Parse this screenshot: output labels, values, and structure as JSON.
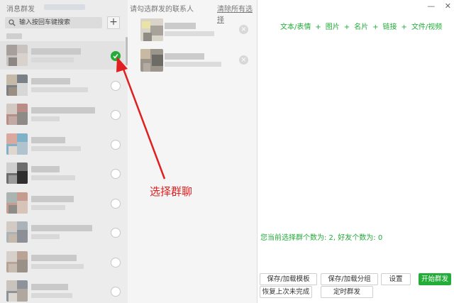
{
  "left": {
    "title": "消息群发",
    "search_placeholder": "输入按回车键搜索",
    "add_label": "+",
    "contacts": [
      {
        "checked": true
      },
      {
        "checked": false
      },
      {
        "checked": false
      },
      {
        "checked": false
      },
      {
        "checked": false
      },
      {
        "checked": false
      },
      {
        "checked": false
      },
      {
        "checked": false
      },
      {
        "checked": false
      }
    ]
  },
  "middle": {
    "title": "请勾选群发的联系人",
    "clear_all": "清除所有选择",
    "remove_glyph": "×"
  },
  "annotation": {
    "text": "选择群聊",
    "color": "#e02020"
  },
  "right": {
    "window_controls": {
      "minimize": "—",
      "close": "✕"
    },
    "toolbar": {
      "text_emoji": "文本/表情",
      "image": "图片",
      "card": "名片",
      "link": "链接",
      "file_video": "文件/视频",
      "separator": "+"
    },
    "status": "您当前选择群个数为: 2, 好友个数为: 0",
    "buttons": {
      "save_load_template": "保存/加载模板",
      "save_load_group": "保存/加载分组",
      "settings": "设置",
      "start_mass_send": "开始群发",
      "resume_unfinished": "恢复上次未完成",
      "scheduled_send": "定时群发"
    }
  },
  "colors": {
    "accent": "#22ac38",
    "annotation_red": "#e02020",
    "left_bg": "#ececec",
    "mid_bg": "#f5f5f5"
  }
}
